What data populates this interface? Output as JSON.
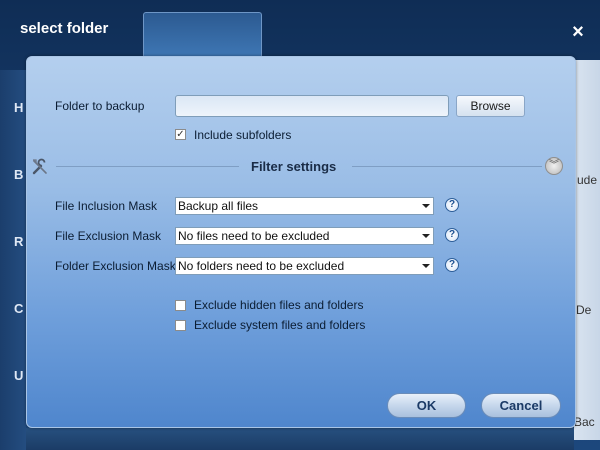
{
  "window": {
    "title": "select folder",
    "close_glyph": "×"
  },
  "background": {
    "side_letters": [
      "H",
      "B",
      "R",
      "C",
      "U"
    ],
    "right_fragments": [
      "ude f",
      "De",
      "Bac"
    ]
  },
  "folder": {
    "label": "Folder to backup",
    "value": "",
    "browse_label": "Browse",
    "include_subfolders_label": "Include subfolders",
    "include_subfolders_checked": true,
    "check_glyph": "✓"
  },
  "filter": {
    "title": "Filter settings",
    "wrench_icon": "wrench-icon",
    "collapse_glyph": "︾",
    "rows": [
      {
        "label": "File Inclusion Mask",
        "value": "Backup all files"
      },
      {
        "label": "File Exclusion Mask",
        "value": "No files need to be excluded"
      },
      {
        "label": "Folder Exclusion Mask",
        "value": "No folders need to be excluded"
      }
    ],
    "help_glyph": "?",
    "exclude_hidden_label": "Exclude hidden files and folders",
    "exclude_system_label": "Exclude system files and folders"
  },
  "actions": {
    "ok_label": "OK",
    "cancel_label": "Cancel"
  }
}
